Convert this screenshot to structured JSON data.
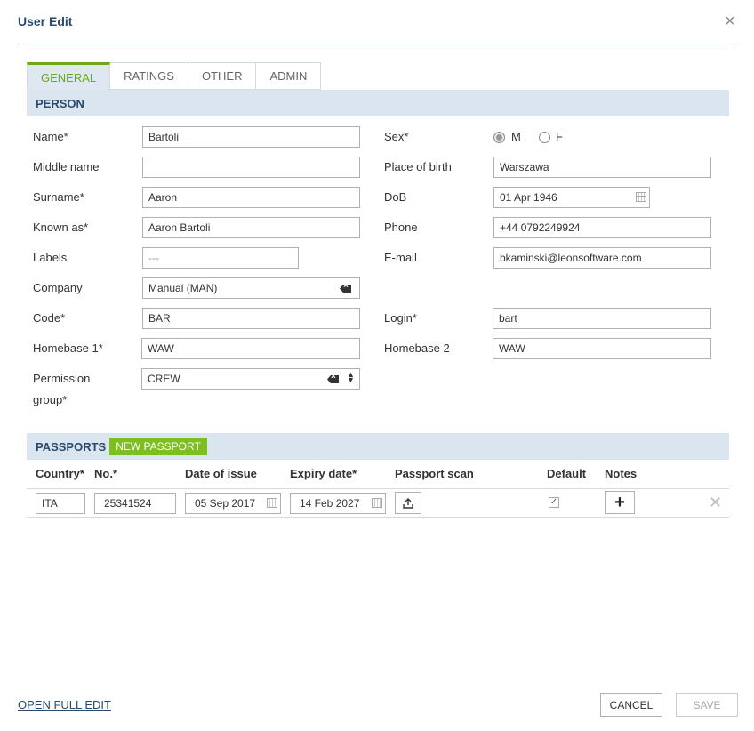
{
  "dialog": {
    "title": "User Edit",
    "close": "×"
  },
  "tabs": [
    {
      "label": "GENERAL",
      "active": true
    },
    {
      "label": "RATINGS",
      "active": false
    },
    {
      "label": "OTHER",
      "active": false
    },
    {
      "label": "ADMIN",
      "active": false
    }
  ],
  "person": {
    "section_title": "PERSON",
    "labels": {
      "name": "Name*",
      "middle_name": "Middle name",
      "surname": "Surname*",
      "known_as": "Known as*",
      "labels": "Labels",
      "company": "Company",
      "code": "Code*",
      "homebase1": "Homebase 1*",
      "permission_group_l1": "Permission",
      "permission_group_l2": "group*",
      "sex": "Sex*",
      "place_of_birth": "Place of birth",
      "dob": "DoB",
      "phone": "Phone",
      "email": "E-mail",
      "login": "Login*",
      "homebase2": "Homebase 2"
    },
    "values": {
      "name": "Bartoli",
      "middle_name": "",
      "surname": "Aaron",
      "known_as": "Aaron Bartoli",
      "labels_placeholder": "---",
      "company": "Manual (MAN)",
      "code": "BAR",
      "homebase1": "WAW",
      "permission_group": "CREW",
      "sex_m": "M",
      "sex_f": "F",
      "sex_selected": "M",
      "place_of_birth": "Warszawa",
      "dob": "01 Apr 1946",
      "phone": "+44 0792249924",
      "email": "bkaminski@leonsoftware.com",
      "login": "bart",
      "homebase2": "WAW"
    }
  },
  "passports": {
    "section_title": "PASSPORTS",
    "new_button": "NEW PASSPORT",
    "columns": [
      "Country*",
      "No.*",
      "Date of issue",
      "Expiry date*",
      "Passport scan",
      "Default",
      "Notes"
    ],
    "rows": [
      {
        "country": "ITA",
        "number": "25341524",
        "date_of_issue": "05 Sep 2017",
        "expiry_date": "14 Feb 2027",
        "default": true
      }
    ]
  },
  "footer": {
    "open_full_edit": "OPEN FULL EDIT",
    "cancel": "CANCEL",
    "save": "SAVE"
  },
  "colors": {
    "accent_green": "#7cbf1e",
    "header_blue": "#2a4a6b",
    "section_bg": "#dbe5ef"
  }
}
